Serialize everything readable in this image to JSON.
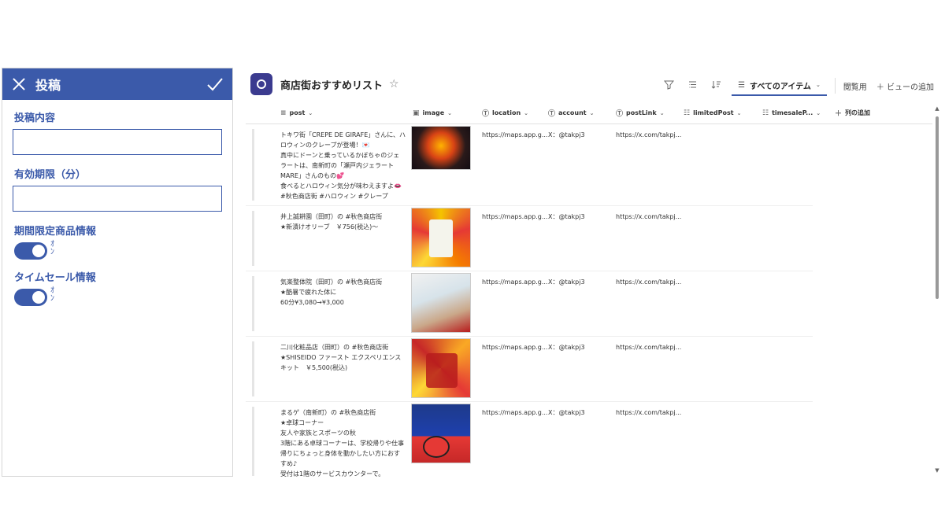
{
  "panel": {
    "title": "投稿",
    "fields": [
      {
        "label": "投稿内容",
        "value": ""
      },
      {
        "label": "有効期限（分）",
        "value": ""
      }
    ],
    "toggles": [
      {
        "label": "期間限定商品情報",
        "value": true
      },
      {
        "label": "タイムセール情報",
        "value": true
      }
    ]
  },
  "list": {
    "title": "商店街おすすめリスト",
    "toolbar": {
      "view_label": "すべてのアイテム",
      "review_label": "閲覧用",
      "add_view_label": "ビューの追加"
    },
    "columns": [
      {
        "label": "post",
        "icon": "text-lines-icon"
      },
      {
        "label": "image",
        "icon": "image-icon"
      },
      {
        "label": "location",
        "icon": "text-field-icon"
      },
      {
        "label": "account",
        "icon": "text-field-icon"
      },
      {
        "label": "postLink",
        "icon": "text-field-icon"
      },
      {
        "label": "limitedPost",
        "icon": "boolean-icon"
      },
      {
        "label": "timesaleP...",
        "icon": "boolean-icon"
      },
      {
        "label": "列の追加",
        "icon": "plus-icon"
      }
    ],
    "rows": [
      {
        "post": [
          "トキワ街「CREPE DE GIRAFE」さんに、ハ",
          "ロウィンのクレープが登場！💌",
          "真中にドーンと乗っているかぼちゃのジェ",
          "ラートは、南新町の「瀬戸内ジェラート",
          "MARE」さんのもの💕",
          "食べるとハロウィン気分が味わえますよ👄",
          "#秋色商店街 #ハロウィン #クレープ"
        ],
        "location": "https://maps.app.g...",
        "account": "X：@takpj3",
        "postLink": "https://x.com/takpj..."
      },
      {
        "post": [
          "井上誠耕園（田町）の #秋色商店街",
          "★新漬けオリーブ　￥756(税込)～"
        ],
        "location": "https://maps.app.g...",
        "account": "X：@takpj3",
        "postLink": "https://x.com/takpj..."
      },
      {
        "post": [
          "気楽整体院（田町）の #秋色商店街",
          "★酷暑で疲れた体に",
          "60分¥3,080→¥3,000"
        ],
        "location": "https://maps.app.g...",
        "account": "X：@takpj3",
        "postLink": "https://x.com/takpj..."
      },
      {
        "post": [
          "二川化粧品店（田町）の #秋色商店街",
          "★SHISEIDO ファースト エクスペリエンス",
          "キット　￥5,500(税込)"
        ],
        "location": "https://maps.app.g...",
        "account": "X：@takpj3",
        "postLink": "https://x.com/takpj..."
      },
      {
        "post": [
          "まるゲ（南新町）の #秋色商店街",
          "★卓球コーナー",
          "友人や家族とスポーツの秋",
          "3階にある卓球コーナーは、学校帰りや仕事",
          "帰りにちょっと身体を動かしたい方におす",
          "すめ♪",
          "受付は1階のサービスカウンターで。"
        ],
        "location": "https://maps.app.g...",
        "account": "X：@takpj3",
        "postLink": "https://x.com/takpj..."
      }
    ]
  },
  "colors": {
    "accent": "#3b5aaa",
    "site_icon": "#3b3b8f"
  }
}
